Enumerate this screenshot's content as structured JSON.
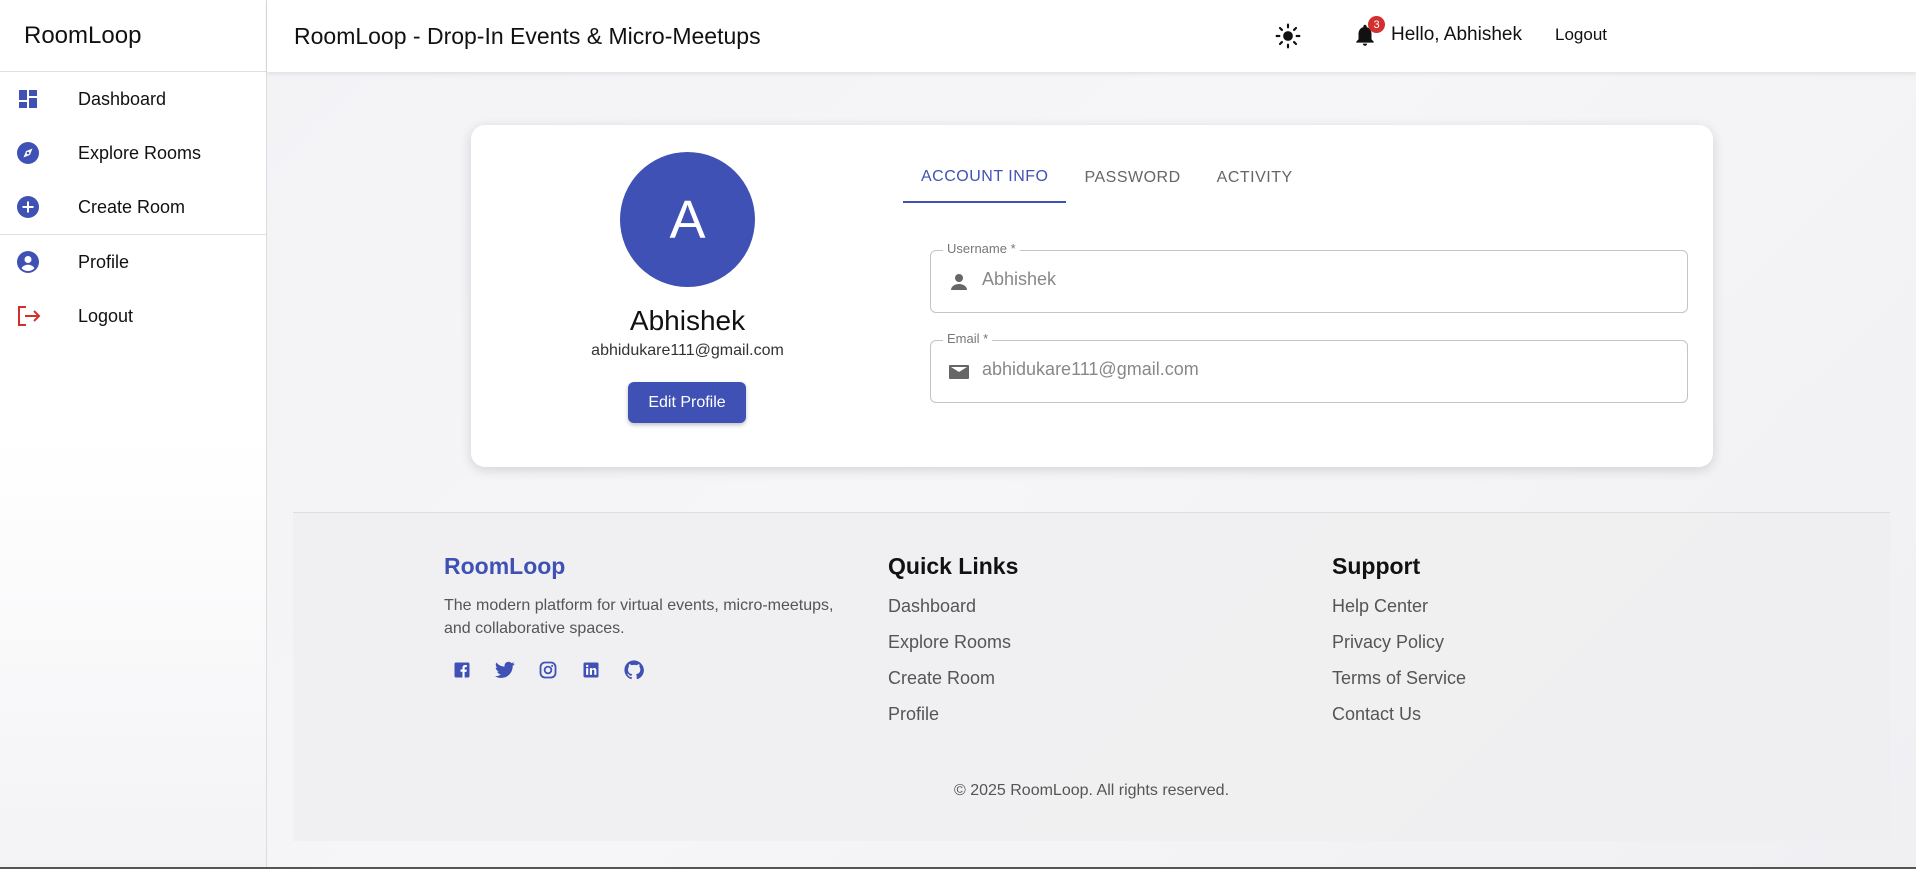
{
  "sidebar": {
    "brand": "RoomLoop",
    "items": [
      {
        "label": "Dashboard",
        "icon": "dashboard-icon"
      },
      {
        "label": "Explore Rooms",
        "icon": "compass-icon"
      },
      {
        "label": "Create Room",
        "icon": "add-circle-icon"
      },
      {
        "label": "Profile",
        "icon": "account-circle-icon"
      },
      {
        "label": "Logout",
        "icon": "logout-icon"
      }
    ]
  },
  "header": {
    "title": "RoomLoop - Drop-In Events & Micro-Meetups",
    "notification_count": "3",
    "greeting": "Hello, Abhishek",
    "logout_label": "Logout"
  },
  "profile": {
    "avatar_letter": "A",
    "name": "Abhishek",
    "email": "abhidukare111@gmail.com",
    "edit_label": "Edit Profile"
  },
  "tabs": [
    {
      "label": "ACCOUNT INFO",
      "active": true
    },
    {
      "label": "PASSWORD",
      "active": false
    },
    {
      "label": "ACTIVITY",
      "active": false
    }
  ],
  "form": {
    "username_label": "Username *",
    "username_value": "Abhishek",
    "email_label": "Email *",
    "email_value": "abhidukare111@gmail.com"
  },
  "footer": {
    "brand": "RoomLoop",
    "description": "The modern platform for virtual events, micro-meetups, and collaborative spaces.",
    "socials": [
      "facebook-icon",
      "twitter-icon",
      "instagram-icon",
      "linkedin-icon",
      "github-icon"
    ],
    "quick_links_heading": "Quick Links",
    "quick_links": [
      "Dashboard",
      "Explore Rooms",
      "Create Room",
      "Profile"
    ],
    "support_heading": "Support",
    "support_links": [
      "Help Center",
      "Privacy Policy",
      "Terms of Service",
      "Contact Us"
    ],
    "copyright": "© 2025 RoomLoop. All rights reserved."
  },
  "colors": {
    "primary": "#3f51b5",
    "logout_red": "#d32f2f",
    "badge_red": "#d32f2f"
  }
}
